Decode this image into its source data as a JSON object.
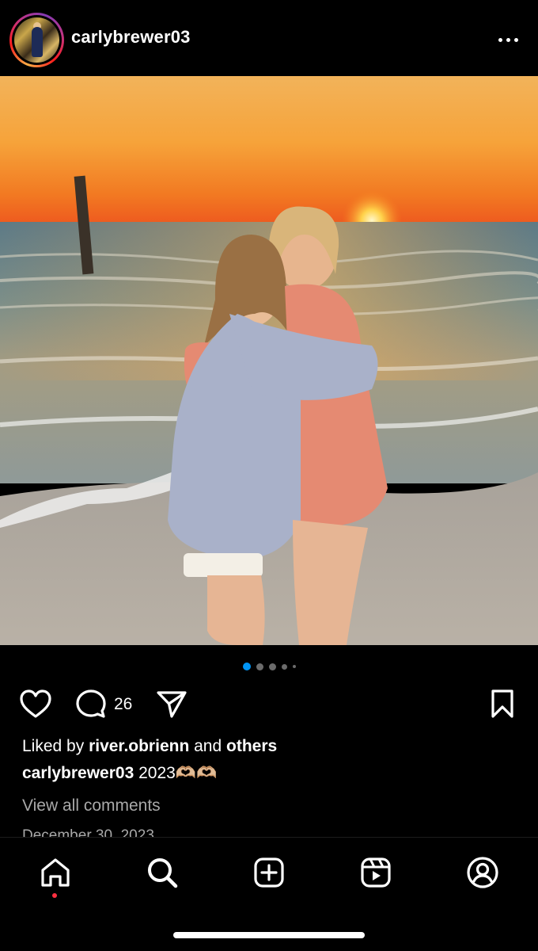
{
  "post": {
    "username": "carlybrewer03",
    "comment_count": "26",
    "liked_by_prefix": "Liked by ",
    "liked_by_user": "river.obrienn",
    "liked_by_and": " and ",
    "liked_by_others": "others",
    "caption_user": "carlybrewer03",
    "caption_text": " 2023🫶🏼🫶🏼",
    "view_comments": "View all comments",
    "date": "December 30, 2023",
    "carousel": {
      "total": 5,
      "active_index": 0
    }
  },
  "icons": {
    "more": "more-options-icon",
    "like": "heart-icon",
    "comment": "comment-bubble-icon",
    "share": "paper-plane-icon",
    "save": "bookmark-icon"
  },
  "tabbar": {
    "tabs": [
      "home-icon",
      "search-icon",
      "create-plus-icon",
      "reels-icon",
      "profile-icon"
    ],
    "active": "home-icon"
  },
  "colors": {
    "background": "#000000",
    "active_dot": "#0095f6",
    "inactive_dot": "#6b6b6b",
    "secondary_text": "#a8a8a8",
    "notification_dot": "#ff3040"
  }
}
